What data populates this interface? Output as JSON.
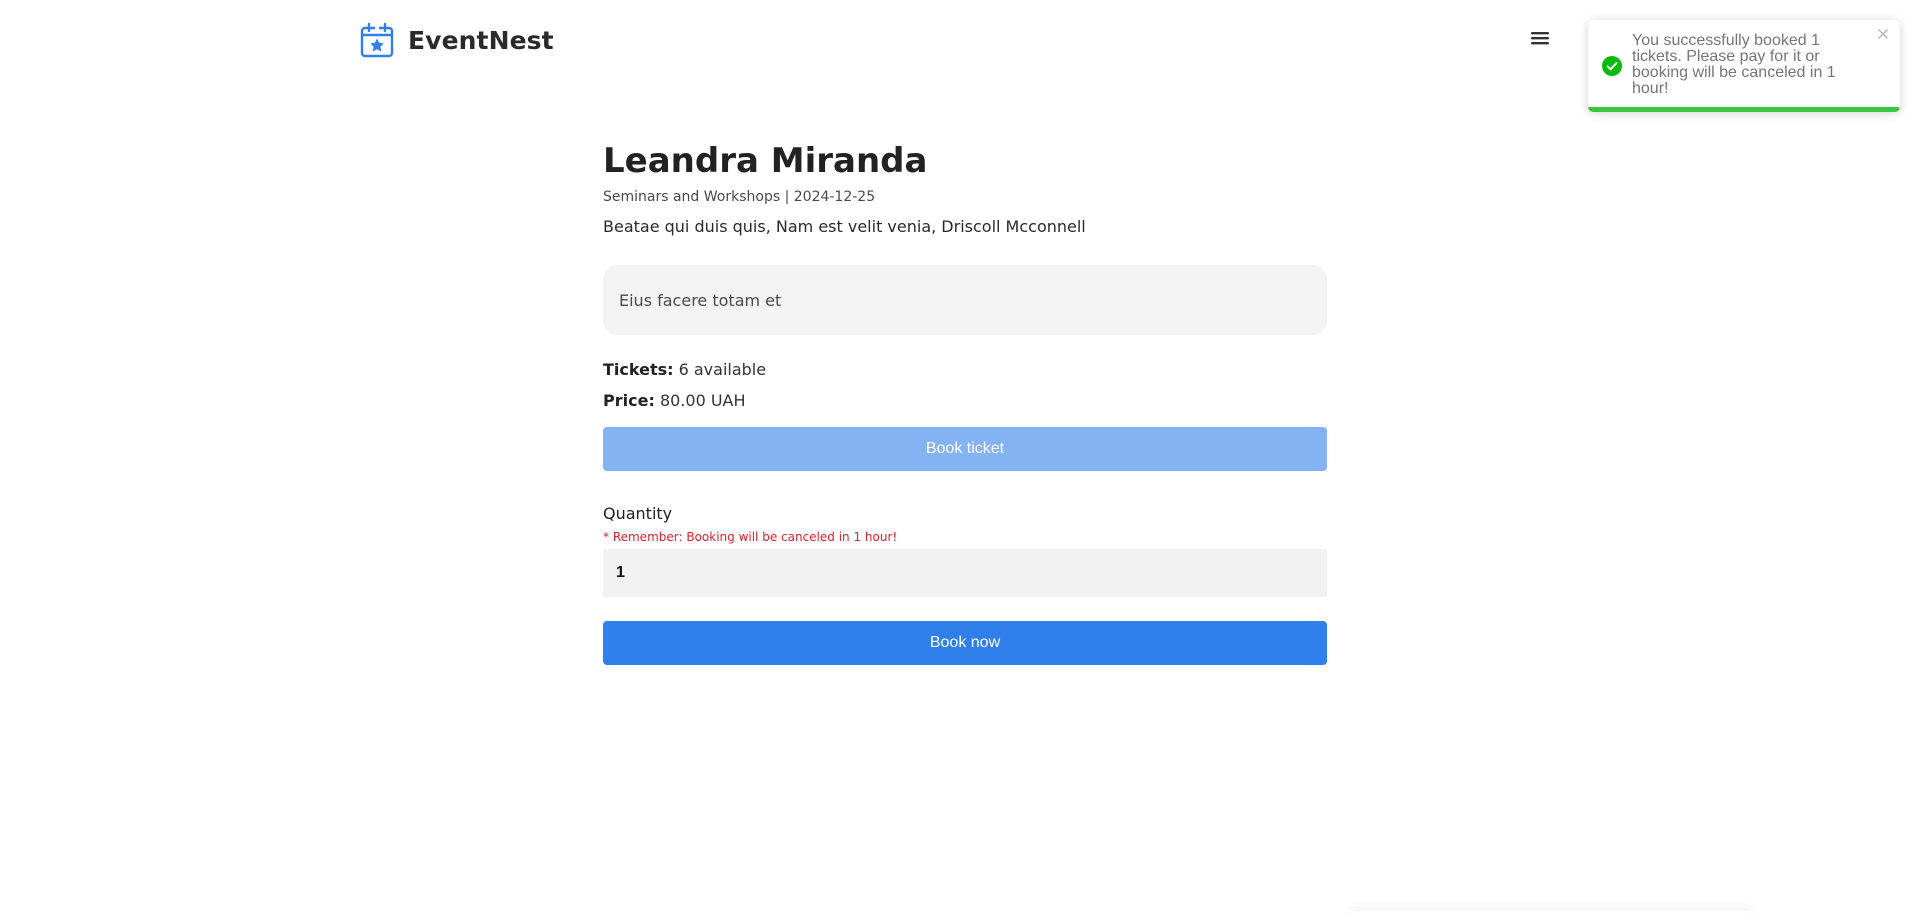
{
  "header": {
    "brand_name": "EventNest",
    "brand_icon": "calendar-star-icon",
    "menu_icon": "hamburger-menu-icon"
  },
  "toast": {
    "type": "success",
    "message": "You successfully booked 1 tickets. Please pay for it or booking will be canceled in 1 hour!",
    "icon": "check-circle-icon",
    "close_icon": "close-icon",
    "progress_percent": 100,
    "color": "#3bc43f"
  },
  "event": {
    "title": "Leandra Miranda",
    "meta": "Seminars and Workshops | 2024-12-25",
    "subtitle": "Beatae qui duis quis, Nam est velit venia, Driscoll Mcconnell",
    "description": "Eius facere totam et",
    "tickets_label": "Tickets:",
    "tickets_value": "6 available",
    "price_label": "Price:",
    "price_value": "80.00 UAH"
  },
  "actions": {
    "book_ticket_label": "Book ticket",
    "book_now_label": "Book now"
  },
  "booking_form": {
    "quantity_label": "Quantity",
    "quantity_note": "* Remember: Booking will be canceled in 1 hour!",
    "quantity_value": "1"
  },
  "colors": {
    "primary": "#2f80ed",
    "primary_disabled": "#83b3f3",
    "brand_icon": "#2f80ed",
    "warning_text": "#e0202a"
  }
}
